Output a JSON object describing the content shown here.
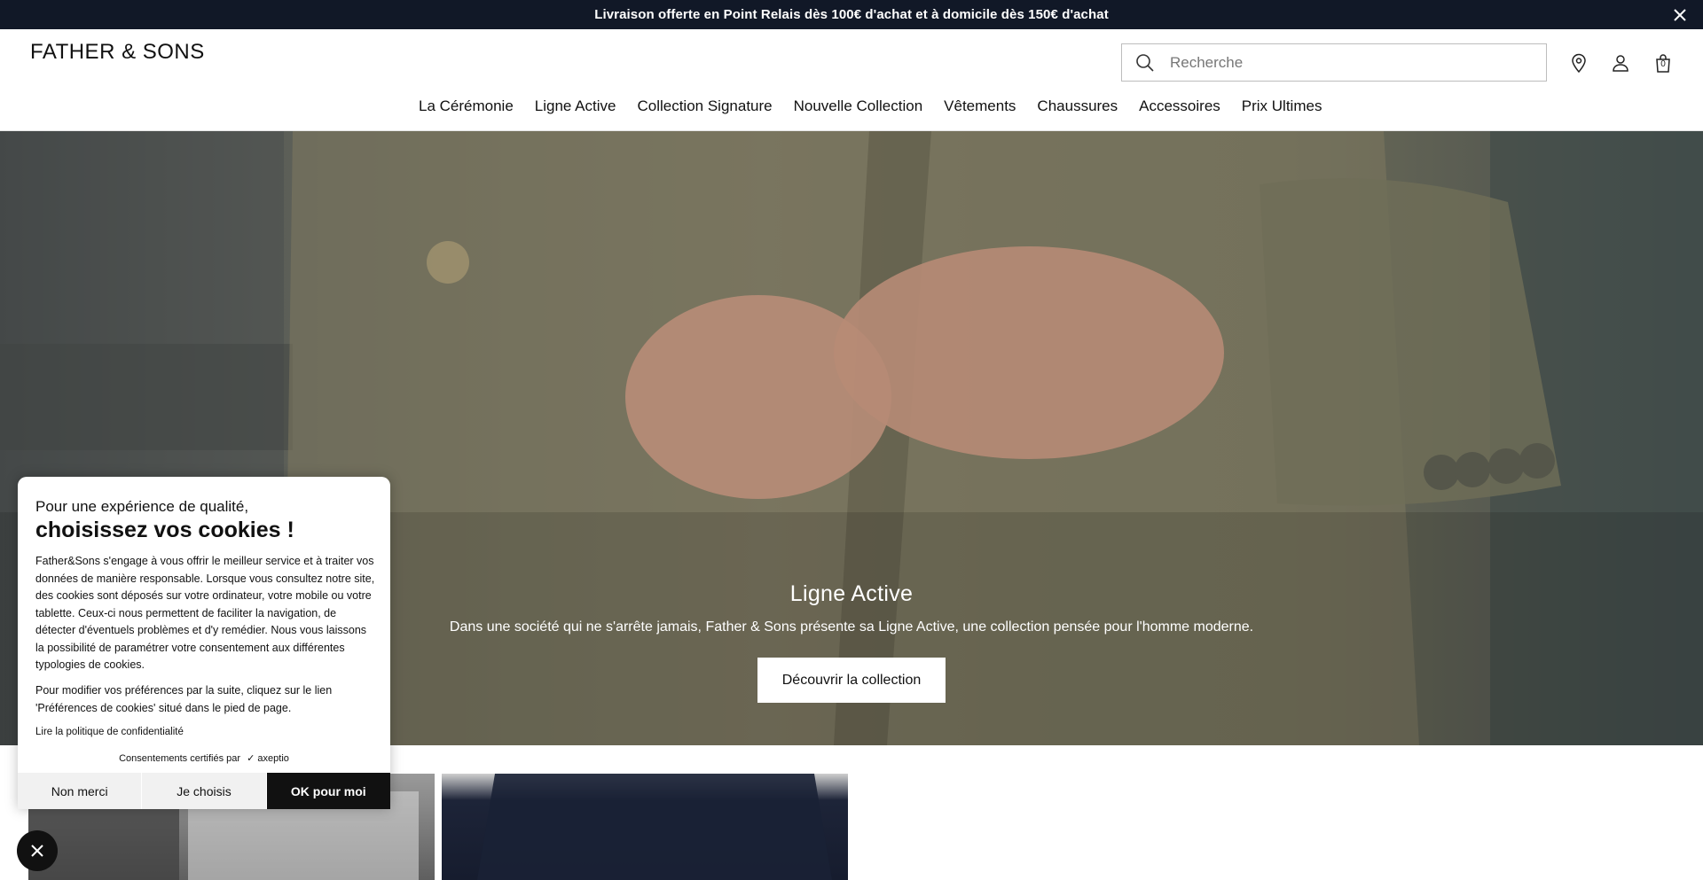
{
  "announcement": {
    "text": "Livraison offerte en Point Relais dès 100€ d'achat et à domicile dès 150€ d'achat",
    "close_icon": "close-icon"
  },
  "header": {
    "logo": "FATHER & SONS",
    "search": {
      "placeholder": "Recherche",
      "value": "",
      "icon": "search-icon"
    },
    "icons": [
      "location-pin-icon",
      "user-icon",
      "shopping-bag-icon"
    ],
    "cart_count": "0"
  },
  "nav": {
    "items": [
      "La Cérémonie",
      "Ligne Active",
      "Collection Signature",
      "Nouvelle Collection",
      "Vêtements",
      "Chaussures",
      "Accessoires",
      "Prix Ultimes"
    ]
  },
  "hero": {
    "title": "Ligne Active",
    "subtitle": "Dans une société qui ne s'arrête jamais, Father & Sons présente sa Ligne Active, une collection pensée pour l'homme moderne.",
    "cta": "Découvrir la collection"
  },
  "cookie": {
    "intro": "Pour une expérience de qualité,",
    "title": "choisissez vos cookies !",
    "body": "Father&Sons s'engage à vous offrir le meilleur service et à traiter vos données de manière responsable. Lorsque vous consultez notre site, des cookies sont déposés sur votre ordinateur, votre mobile ou votre tablette. Ceux-ci nous permettent de faciliter la navigation, de détecter d'éventuels problèmes et d'y remédier. Nous vous laissons la possibilité de paramétrer votre consentement aux différentes typologies de cookies.",
    "body2": "Pour modifier vos préférences par la suite, cliquez sur le lien 'Préférences de cookies' situé dans le pied de page.",
    "privacy_link": "Lire la politique de confidentialité",
    "certified": "Consentements certifiés par",
    "certifier": "axeptio",
    "buttons": {
      "refuse": "Non merci",
      "choose": "Je choisis",
      "accept": "OK pour moi"
    }
  },
  "colors": {
    "announcement_bg": "#111827",
    "accent": "#111111",
    "background": "#ffffff"
  }
}
